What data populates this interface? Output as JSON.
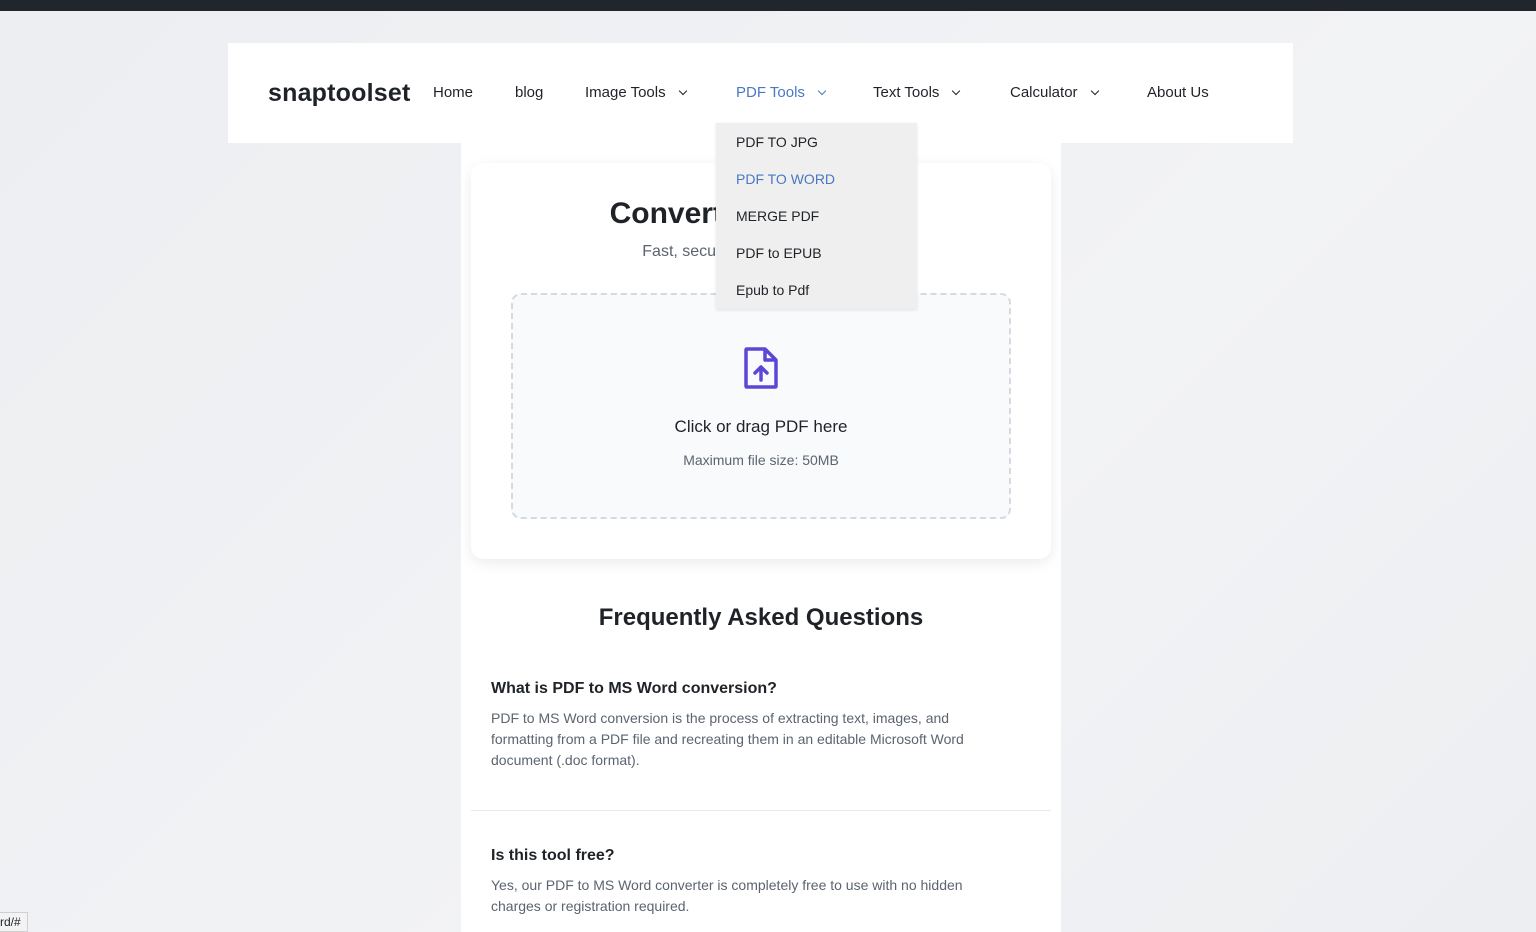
{
  "brand": {
    "logo": "snaptoolset"
  },
  "nav": {
    "items": [
      {
        "label": "Home"
      },
      {
        "label": "blog"
      },
      {
        "label": "Image Tools"
      },
      {
        "label": "PDF Tools"
      },
      {
        "label": "Text Tools"
      },
      {
        "label": "Calculator"
      },
      {
        "label": "About Us"
      }
    ]
  },
  "dropdown": {
    "items": [
      {
        "label": "PDF TO JPG"
      },
      {
        "label": "PDF TO WORD"
      },
      {
        "label": "MERGE PDF"
      },
      {
        "label": "PDF to EPUB"
      },
      {
        "label": "Epub to Pdf"
      }
    ]
  },
  "converter": {
    "title": "Convert PDF to Word",
    "subtitle": "Fast, secure, and free conversion",
    "dropzone_title": "Click or drag PDF here",
    "dropzone_sub": "Maximum file size: 50MB"
  },
  "faq": {
    "title": "Frequently Asked Questions",
    "items": [
      {
        "q": "What is PDF to MS Word conversion?",
        "a": "PDF to MS Word conversion is the process of extracting text, images, and formatting from a PDF file and recreating them in an editable Microsoft Word document (.doc format)."
      },
      {
        "q": "Is this tool free?",
        "a": "Yes, our PDF to MS Word converter is completely free to use with no hidden charges or registration required."
      }
    ]
  },
  "status": {
    "url": "rd/#"
  },
  "colors": {
    "accent": "#4a78c2",
    "icon": "#5b46d6"
  }
}
